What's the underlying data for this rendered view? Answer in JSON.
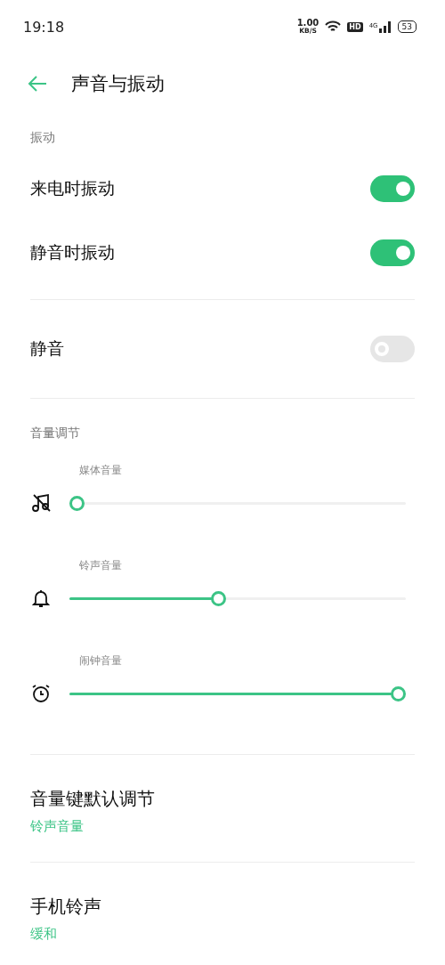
{
  "status_bar": {
    "time": "19:18",
    "speed_value": "1.00",
    "speed_unit": "KB/S",
    "hd": "HD",
    "network": "4G",
    "battery": "53"
  },
  "header": {
    "title": "声音与振动"
  },
  "vibration": {
    "heading": "振动",
    "items": [
      {
        "label": "来电时振动",
        "on": true
      },
      {
        "label": "静音时振动",
        "on": true
      }
    ]
  },
  "silent": {
    "label": "静音",
    "on": false
  },
  "volume": {
    "heading": "音量调节",
    "sliders": [
      {
        "kind": "media",
        "label": "媒体音量",
        "level": 0
      },
      {
        "kind": "ring",
        "label": "铃声音量",
        "level": 0.44
      },
      {
        "kind": "alarm",
        "label": "闹钟音量",
        "level": 1
      }
    ]
  },
  "settings": [
    {
      "title": "音量键默认调节",
      "value": "铃声音量"
    },
    {
      "title": "手机铃声",
      "value": "缓和"
    }
  ]
}
